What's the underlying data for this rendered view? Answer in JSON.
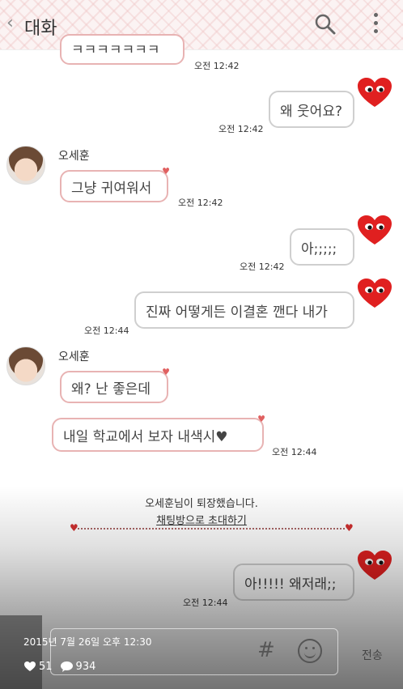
{
  "header": {
    "back_icon": "chevron-left-icon",
    "title": "대화",
    "search_icon": "search-icon",
    "more_icon": "more-vertical-icon"
  },
  "messages": [
    {
      "sender": "",
      "text": "ㅋㅋㅋㅋㅋㅋㅋ",
      "time": "오전 12:42",
      "from_me": false
    },
    {
      "sender": "me",
      "text": "왜 웃어요?",
      "time": "오전 12:42",
      "from_me": true
    },
    {
      "sender": "오세훈",
      "text": "그냥 귀여워서",
      "time": "오전 12:42",
      "from_me": false
    },
    {
      "sender": "me",
      "text": "아;;;;;",
      "time": "오전 12:42",
      "from_me": true
    },
    {
      "sender": "me",
      "text": "진짜 어떻게든 이결혼 깬다 내가",
      "time": "오전 12:44",
      "from_me": true
    },
    {
      "sender": "오세훈",
      "text": "왜? 난 좋은데",
      "time": "",
      "from_me": false
    },
    {
      "sender": "오세훈",
      "text": "내일 학교에서 보자 내색시♥",
      "time": "오전 12:44",
      "from_me": false
    },
    {
      "sender": "me",
      "text": "아!!!!! 왜저래;;",
      "time": "오전 12:44",
      "from_me": true
    }
  ],
  "system": {
    "left_notice": "오세훈님이 퇴장했습니다.",
    "invite_link": "채팅방으로 초대하기"
  },
  "input_bar": {
    "hash_icon": "hash-icon",
    "emoji_icon": "emoji-icon",
    "send_label": "전송"
  },
  "post_meta": {
    "date": "2015년 7월 26일 오후 12:30",
    "likes": "51",
    "comments": "934"
  },
  "colors": {
    "bubble_border_other": "#e8b3b3",
    "bubble_border_me": "#cfcfcf",
    "heart": "#e02020"
  }
}
